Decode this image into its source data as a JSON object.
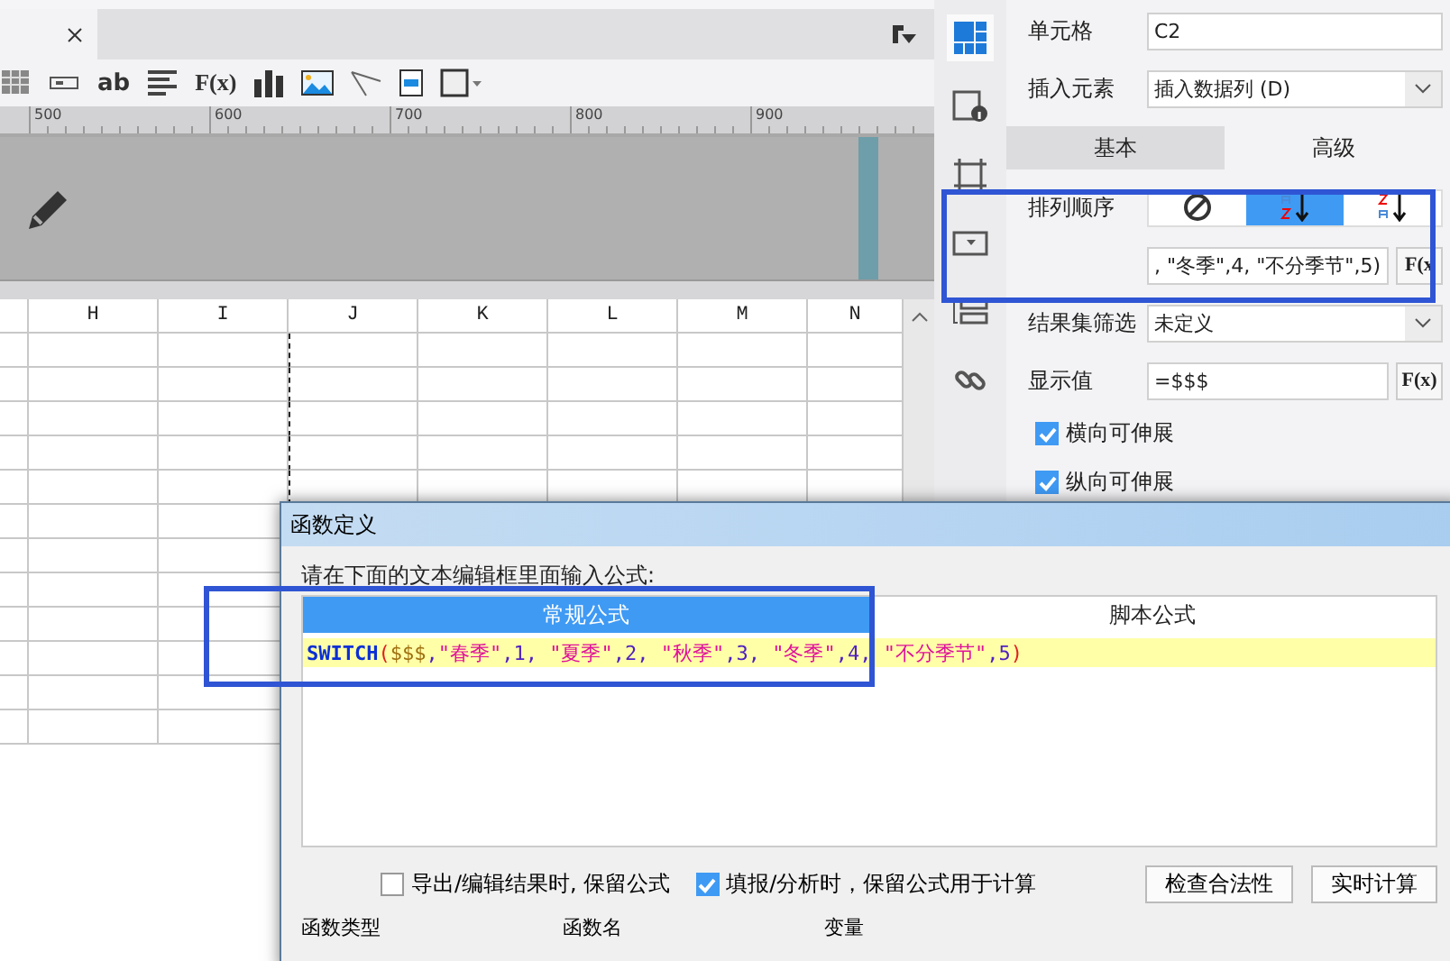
{
  "doc_tab": {
    "selected": true
  },
  "toolbar": [
    {
      "kind": "grid"
    },
    {
      "kind": "field"
    },
    {
      "kind": "text",
      "label": "ab"
    },
    {
      "kind": "align"
    },
    {
      "kind": "formula",
      "label": "F(x)"
    },
    {
      "kind": "chart"
    },
    {
      "kind": "image"
    },
    {
      "kind": "slash"
    },
    {
      "kind": "frame"
    },
    {
      "kind": "border"
    }
  ],
  "ruler": [
    "500",
    "600",
    "700",
    "800",
    "900"
  ],
  "sheet": {
    "columns": [
      "H",
      "I",
      "J",
      "K",
      "L",
      "M",
      "N"
    ]
  },
  "panel": {
    "cell": {
      "label": "单元格",
      "value": "C2"
    },
    "insert": {
      "label": "插入元素",
      "value": "插入数据列 (D)"
    },
    "tabs": [
      {
        "label": "基本",
        "selected": true
      },
      {
        "label": "高级",
        "selected": false
      }
    ],
    "sort": {
      "label": "排列顺序",
      "options": [
        {
          "kind": "none",
          "selected": false
        },
        {
          "kind": "asc",
          "selected": true
        },
        {
          "kind": "desc",
          "selected": false
        }
      ],
      "formula": ", \"冬季\",4, \"不分季节\",5)",
      "fx": "F(x"
    },
    "filter": {
      "label": "结果集筛选",
      "value": "未定义"
    },
    "display": {
      "label": "显示值",
      "value": "=$$$",
      "fx": "F(x)"
    },
    "checks": [
      {
        "label": "横向可伸展",
        "checked": true
      },
      {
        "label": "纵向可伸展",
        "checked": true
      }
    ]
  },
  "dialog": {
    "title": "函数定义",
    "prompt": "请在下面的文本编辑框里面输入公式:",
    "tabs": [
      {
        "label": "常规公式",
        "selected": true
      },
      {
        "label": "脚本公式",
        "selected": false
      }
    ],
    "formula": [
      {
        "kind": "func",
        "text": "SWITCH"
      },
      {
        "kind": "paren",
        "text": "("
      },
      {
        "kind": "var",
        "text": "$$$"
      },
      {
        "kind": "punct",
        "text": ","
      },
      {
        "kind": "str",
        "text": "\"春季\""
      },
      {
        "kind": "punct",
        "text": ",1, "
      },
      {
        "kind": "str",
        "text": "\"夏季\""
      },
      {
        "kind": "punct",
        "text": ",2, "
      },
      {
        "kind": "str",
        "text": "\"秋季\""
      },
      {
        "kind": "punct",
        "text": ",3, "
      },
      {
        "kind": "str",
        "text": "\"冬季\""
      },
      {
        "kind": "punct",
        "text": ",4, "
      },
      {
        "kind": "str",
        "text": "\"不分季节\""
      },
      {
        "kind": "punct",
        "text": ",5"
      },
      {
        "kind": "paren",
        "text": ")"
      }
    ],
    "options": [
      {
        "label": "导出/编辑结果时, 保留公式",
        "checked": false
      },
      {
        "label": "填报/分析时，保留公式用于计算",
        "checked": true
      }
    ],
    "buttons": [
      "检查合法性",
      "实时计算"
    ],
    "footer": [
      "函数类型",
      "函数名",
      "变量"
    ]
  }
}
